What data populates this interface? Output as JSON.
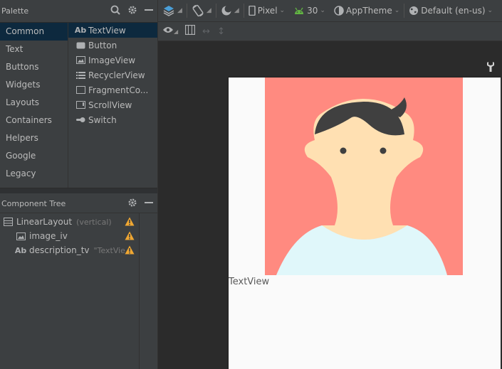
{
  "palette": {
    "title": "Palette",
    "categories": [
      "Common",
      "Text",
      "Buttons",
      "Widgets",
      "Layouts",
      "Containers",
      "Helpers",
      "Google",
      "Legacy"
    ],
    "items": [
      {
        "label": "TextView",
        "icon": "textview-icon"
      },
      {
        "label": "Button",
        "icon": "button-icon"
      },
      {
        "label": "ImageView",
        "icon": "imageview-icon"
      },
      {
        "label": "RecyclerView",
        "icon": "list-icon"
      },
      {
        "label": "FragmentCo...",
        "icon": "fragment-icon"
      },
      {
        "label": "ScrollView",
        "icon": "scrollview-icon"
      },
      {
        "label": "Switch",
        "icon": "switch-icon"
      }
    ]
  },
  "component_tree": {
    "title": "Component Tree",
    "nodes": [
      {
        "label": "LinearLayout",
        "sub": "(vertical)",
        "icon": "linearlayout-icon"
      },
      {
        "label": "image_iv",
        "sub": "",
        "icon": "imageview-icon"
      },
      {
        "label": "description_tv",
        "sub": "\"TextVie...",
        "icon": "textview-icon"
      }
    ]
  },
  "toolbar": {
    "device": "Pixel",
    "api": "30",
    "theme": "AppTheme",
    "locale": "Default (en-us)"
  },
  "preview": {
    "text": "TextView"
  },
  "colors": {
    "accent_selected": "#0d293e",
    "warning": "#f0a732",
    "avatar_bg": "#ff8a80",
    "skin": "#ffe0b2",
    "hair": "#404040",
    "shirt": "#e0f7fa"
  }
}
